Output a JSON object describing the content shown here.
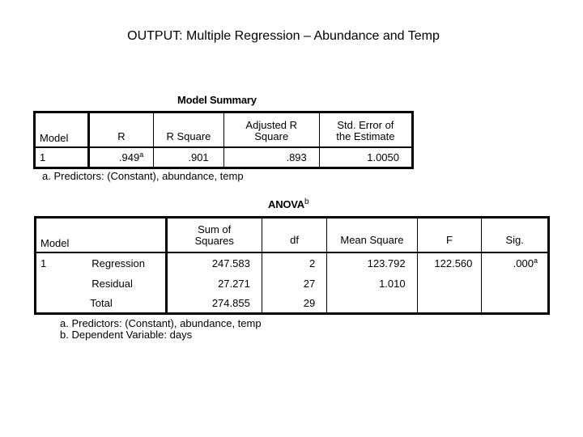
{
  "page": {
    "title": "OUTPUT: Multiple Regression – Abundance and Temp"
  },
  "model_summary": {
    "caption": "Model Summary",
    "headers": {
      "model": "Model",
      "r": "R",
      "r_square": "R Square",
      "adj_r_square_line1": "Adjusted R",
      "adj_r_square_line2": "Square",
      "std_err_line1": "Std. Error of",
      "std_err_line2": "the Estimate"
    },
    "rows": [
      {
        "model": "1",
        "r": ".949",
        "r_sup": "a",
        "r_square": ".901",
        "adj_r_square": ".893",
        "std_err": "1.0050"
      }
    ],
    "footnotes": [
      "a. Predictors: (Constant), abundance, temp"
    ]
  },
  "anova": {
    "caption": "ANOVA",
    "caption_sup": "b",
    "headers": {
      "model": "Model",
      "ss_line1": "Sum of",
      "ss_line2": "Squares",
      "df": "df",
      "ms": "Mean Square",
      "f": "F",
      "sig": "Sig."
    },
    "model_number": "1",
    "rows": [
      {
        "source": "Regression",
        "ss": "247.583",
        "df": "2",
        "ms": "123.792",
        "f": "122.560",
        "sig": ".000",
        "sig_sup": "a"
      },
      {
        "source": "Residual",
        "ss": "27.271",
        "df": "27",
        "ms": "1.010",
        "f": "",
        "sig": ""
      },
      {
        "source": "Total",
        "ss": "274.855",
        "df": "29",
        "ms": "",
        "f": "",
        "sig": ""
      }
    ],
    "footnotes": [
      "a. Predictors: (Constant), abundance, temp",
      "b. Dependent Variable: days"
    ]
  }
}
